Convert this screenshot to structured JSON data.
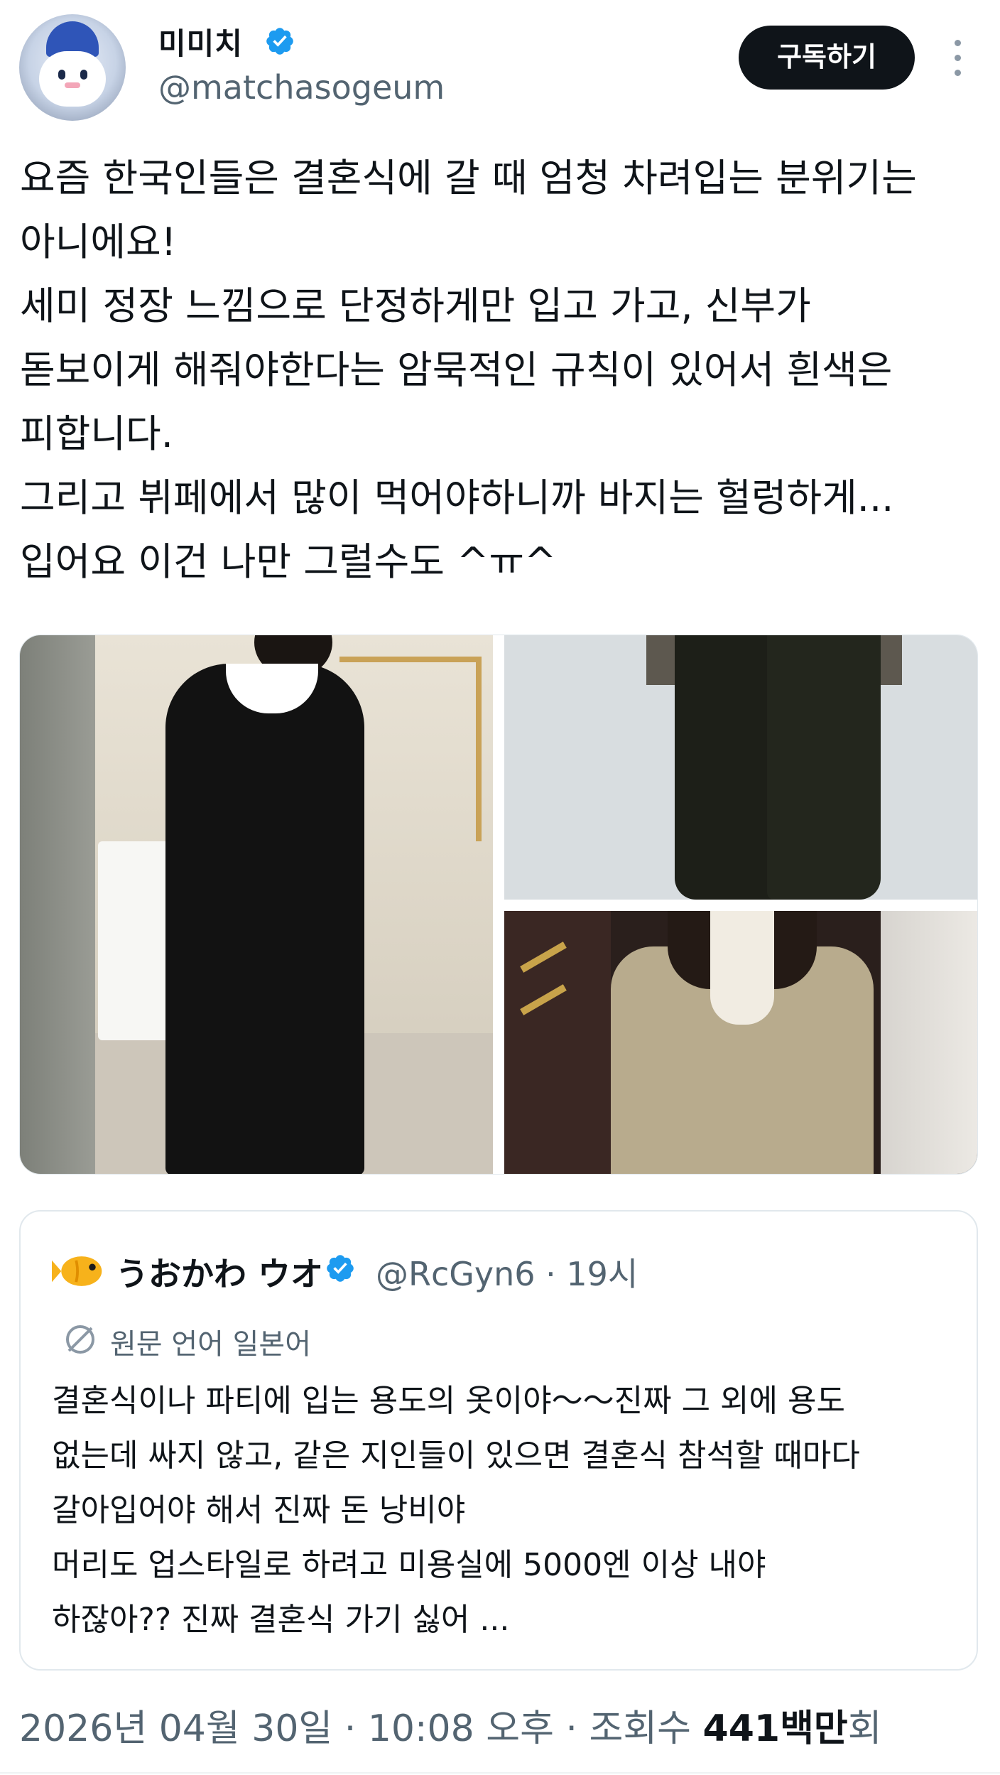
{
  "author": {
    "display_name": "미미치",
    "handle": "@matchasogeum",
    "verified": true,
    "avatar_icon": "mascot-avatar-icon"
  },
  "actions": {
    "subscribe_label": "구독하기",
    "more_icon": "more-options-icon"
  },
  "tweet": {
    "text": "요즘 한국인들은 결혼식에 갈 때 엄청 차려입는 분위기는\n아니에요!\n세미 정장 느낌으로 단정하게만 입고 가고, 신부가\n돋보이게 해줘야한다는 암묵적인 규칙이 있어서 흰색은\n피합니다.\n그리고 뷔페에서 많이 먹어야하니까 바지는 헐렁하게...\n입어요 이건 나만 그럴수도 ^ㅠ^"
  },
  "quote": {
    "display_name": "うおかわ ウオ",
    "handle_time": "@RcGyn6 · 19시",
    "verified": true,
    "avatar_icon": "fish-icon",
    "translate_label": "원문 언어 일본어",
    "text": "결혼식이나 파티에 입는 용도의 옷이야〜〜진짜 그 외에 용도\n없는데 싸지 않고, 같은 지인들이 있으면 결혼식 참석할 때마다\n갈아입어야 해서 진짜 돈 낭비야\n머리도 업스타일로 하려고 미용실에 5000엔 이상 내야\n하잖아?? 진짜 결혼식 가기 싫어  ..."
  },
  "meta": {
    "datetime": "2026년 04월 30일 · 10:08 오후 · 조회수 ",
    "views": "441백만",
    "views_suffix": "회"
  },
  "colors": {
    "verified_blue": "#1d9bf0",
    "text_primary": "#0f1419",
    "text_secondary": "#536471",
    "button_bg": "#0f1419"
  }
}
